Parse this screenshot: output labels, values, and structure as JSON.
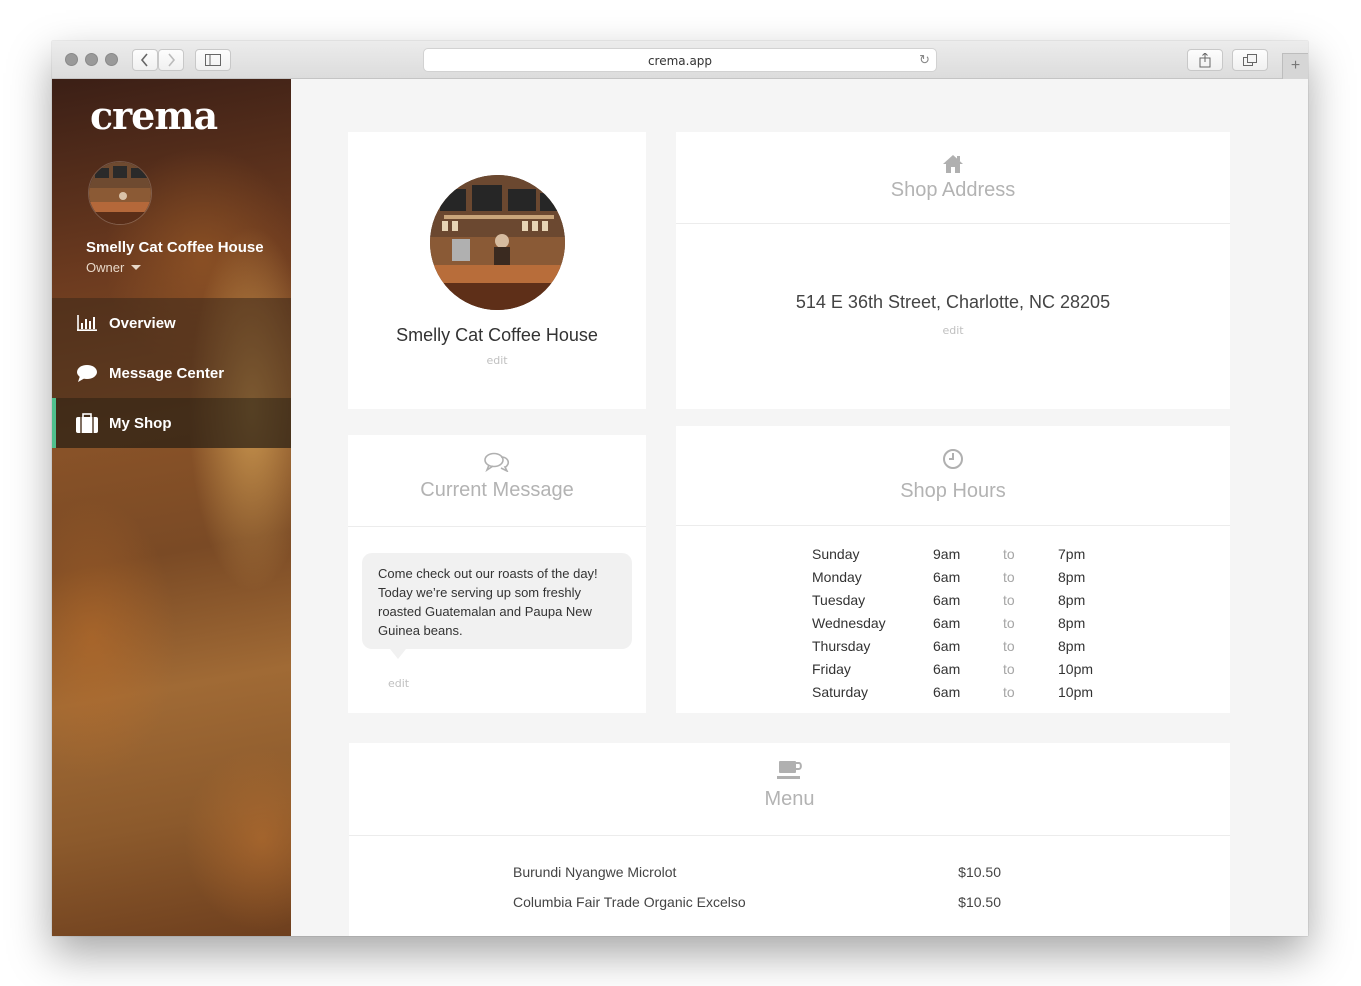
{
  "browser": {
    "url": "crema.app"
  },
  "sidebar": {
    "logo": "crema",
    "shop_name": "Smelly Cat Coffee House",
    "role": "Owner",
    "nav": [
      {
        "label": "Overview",
        "icon": "bar-chart-icon"
      },
      {
        "label": "Message Center",
        "icon": "speech-bubble-icon"
      },
      {
        "label": "My Shop",
        "icon": "briefcase-icon",
        "active": true
      }
    ]
  },
  "profile": {
    "name": "Smelly Cat Coffee House",
    "edit": "edit"
  },
  "address": {
    "title": "Shop Address",
    "value": "514 E 36th Street, Charlotte, NC 28205",
    "edit": "edit"
  },
  "message": {
    "title": "Current Message",
    "text": "Come check out our roasts of the day! Today we’re serving up som freshly roasted Guatemalan and Paupa New Guinea beans.",
    "edit": "edit"
  },
  "hours": {
    "title": "Shop Hours",
    "rows": [
      {
        "day": "Sunday",
        "open": "9am",
        "to": "to",
        "close": "7pm"
      },
      {
        "day": "Monday",
        "open": "6am",
        "to": "to",
        "close": "8pm"
      },
      {
        "day": "Tuesday",
        "open": "6am",
        "to": "to",
        "close": "8pm"
      },
      {
        "day": "Wednesday",
        "open": "6am",
        "to": "to",
        "close": "8pm"
      },
      {
        "day": "Thursday",
        "open": "6am",
        "to": "to",
        "close": "8pm"
      },
      {
        "day": "Friday",
        "open": "6am",
        "to": "to",
        "close": "10pm"
      },
      {
        "day": "Saturday",
        "open": "6am",
        "to": "to",
        "close": "10pm"
      }
    ]
  },
  "menu": {
    "title": "Menu",
    "items": [
      {
        "name": "Burundi Nyangwe Microlot",
        "price": "$10.50"
      },
      {
        "name": "Columbia Fair Trade Organic Excelso",
        "price": "$10.50"
      }
    ]
  },
  "colors": {
    "accent": "#4fc08d",
    "card_bg": "#ffffff",
    "page_bg": "#f5f5f5",
    "muted": "#b3b3b3"
  }
}
